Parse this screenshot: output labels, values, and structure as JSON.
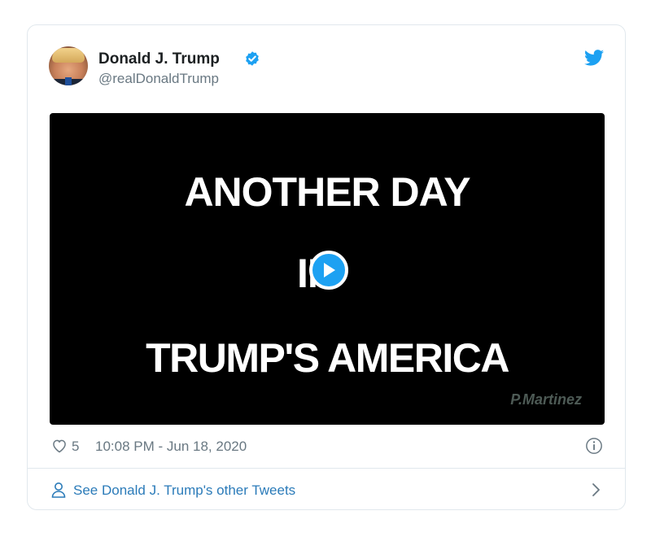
{
  "author": {
    "name": "Donald J. Trump",
    "handle": "@realDonaldTrump"
  },
  "media": {
    "line1": "ANOTHER DAY",
    "line2": "IN",
    "line3": "TRUMP'S AMERICA",
    "watermark": "P.Martinez"
  },
  "footer": {
    "likes": "5",
    "timestamp": "10:08 PM - Jun 18, 2020"
  },
  "see_more": {
    "label": "See Donald J. Trump's other Tweets"
  },
  "colors": {
    "accent": "#1da1f2",
    "link": "#2b7bb9",
    "muted": "#697882",
    "border": "#e1e8ed"
  },
  "icons": {
    "verified": "verified-badge-icon",
    "brand": "twitter-bird-icon",
    "like": "heart-icon",
    "info": "info-icon",
    "person": "person-icon",
    "chevron": "chevron-right-icon",
    "play": "play-icon"
  }
}
